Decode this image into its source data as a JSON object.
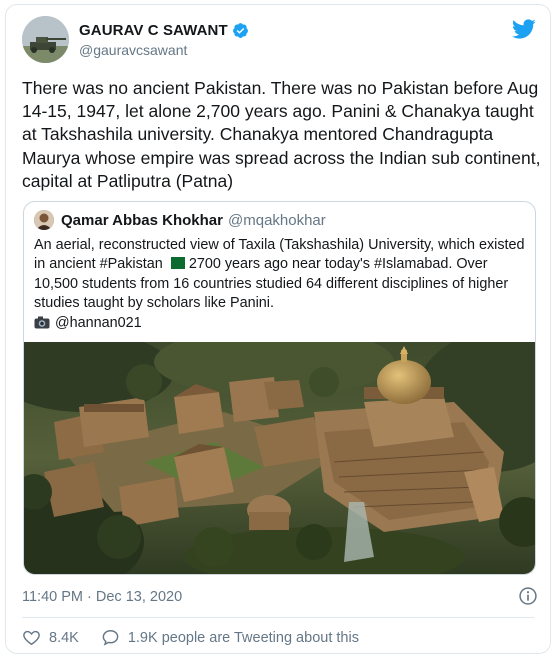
{
  "author": {
    "name": "GAURAV C SAWANT",
    "handle": "@gauravcsawant",
    "avatar_icon": "avatar-photo-icon",
    "verified_icon": "verified-badge-icon"
  },
  "brand": {
    "icon": "twitter-bird-icon",
    "color": "#1da1f2"
  },
  "tweet": {
    "text": "There was no ancient Pakistan. There was no Pakistan before Aug 14-15, 1947, let alone 2,700 years ago. Panini & Chanakya taught at Takshashila university. Chanakya mentored Chandragupta Maurya whose empire was spread across the Indian sub continent, capital at Patliputra (Patna)"
  },
  "quoted": {
    "name": "Qamar Abbas Khokhar",
    "handle": "@mqakhokhar",
    "text_part1": "An aerial, reconstructed view of Taxila (Takshashila) University, which existed in ancient #Pakistan",
    "text_part2": "2700 years ago near today's #Islamabad. Over 10,500 students from 16 countries studied 64 different disciplines of higher studies taught by scholars like Panini.",
    "credit": "@hannan021",
    "flag_icon": "pakistan-flag-icon",
    "camera_icon": "camera-icon",
    "image_name": "taxila-aerial-illustration"
  },
  "meta": {
    "time": "11:40 PM · Dec 13, 2020",
    "info_icon": "info-icon"
  },
  "actions": {
    "likes": "8.4K",
    "comments_text": "1.9K people are Tweeting about this"
  },
  "colors": {
    "text": "#14171a",
    "secondary": "#657786",
    "border": "#e1e8ed",
    "like": "#e0245e"
  }
}
